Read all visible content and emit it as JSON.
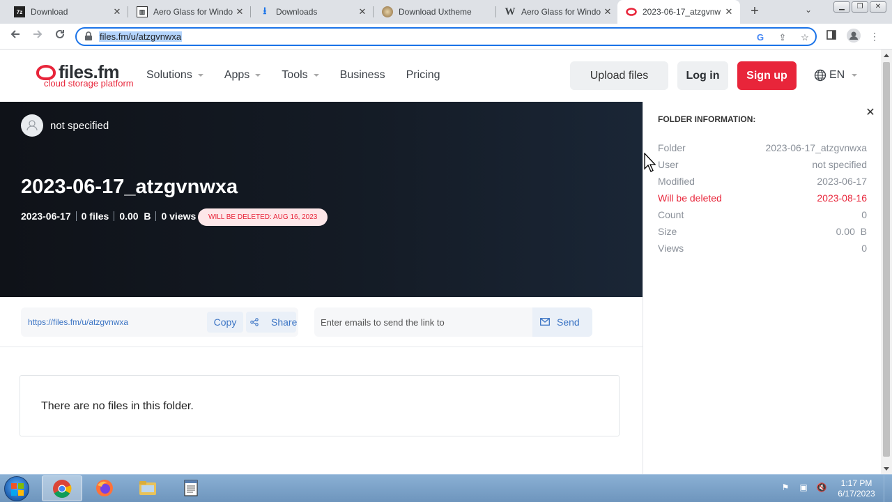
{
  "browser": {
    "tabs": [
      {
        "title": "Download",
        "favicon": "7z-icon",
        "active": false
      },
      {
        "title": "Aero Glass for Windo",
        "favicon": "page-icon",
        "active": false
      },
      {
        "title": "Downloads",
        "favicon": "download-arrow-icon",
        "active": false
      },
      {
        "title": "Download Uxtheme",
        "favicon": "uxtheme-icon",
        "active": false
      },
      {
        "title": "Aero Glass for Windo",
        "favicon": "w-letter-icon",
        "active": false
      },
      {
        "title": "2023-06-17_atzgvnw",
        "favicon": "filesfm-icon",
        "active": true
      }
    ],
    "new_tab_label": "+",
    "url": "files.fm/u/atzgvnwxa",
    "accent": "#1a73e8"
  },
  "site": {
    "logo_text": "files.fm",
    "logo_tagline": "cloud storage platform",
    "brand_color": "#e8253a",
    "nav": [
      {
        "label": "Solutions",
        "has_dropdown": true
      },
      {
        "label": "Apps",
        "has_dropdown": true
      },
      {
        "label": "Tools",
        "has_dropdown": true
      },
      {
        "label": "Business",
        "has_dropdown": false
      },
      {
        "label": "Pricing",
        "has_dropdown": false
      }
    ],
    "upload_label": "Upload files",
    "login_label": "Log in",
    "signup_label": "Sign up",
    "language": "EN"
  },
  "folder": {
    "owner": "not specified",
    "title": "2023-06-17_atzgvnwxa",
    "meta": {
      "date": "2023-06-17",
      "files": "0 files",
      "size": "0.00  B",
      "views": "0 views"
    },
    "delete_badge": "WILL BE DELETED: AUG 16, 2023",
    "share_link": "https://files.fm/u/atzgvnwxa",
    "copy_label": "Copy",
    "share_label": "Share",
    "email_placeholder": "Enter emails to send the link to",
    "send_label": "Send",
    "empty_message": "There are no files in this folder."
  },
  "info_panel": {
    "title": "FOLDER INFORMATION:",
    "rows": [
      {
        "label": "Folder",
        "value": "2023-06-17_atzgvnwxa",
        "warn": false
      },
      {
        "label": "User",
        "value": "not specified",
        "warn": false
      },
      {
        "label": "Modified",
        "value": "2023-06-17",
        "warn": false
      },
      {
        "label": "Will be deleted",
        "value": "2023-08-16",
        "warn": true
      },
      {
        "label": "Count",
        "value": "0",
        "warn": false
      },
      {
        "label": "Size",
        "value": "0.00  B",
        "warn": false
      },
      {
        "label": "Views",
        "value": "0",
        "warn": false
      }
    ]
  },
  "taskbar": {
    "apps": [
      "chrome-icon",
      "firefox-icon",
      "file-explorer-icon",
      "notepad-icon"
    ],
    "time": "1:17 PM",
    "date": "6/17/2023"
  }
}
